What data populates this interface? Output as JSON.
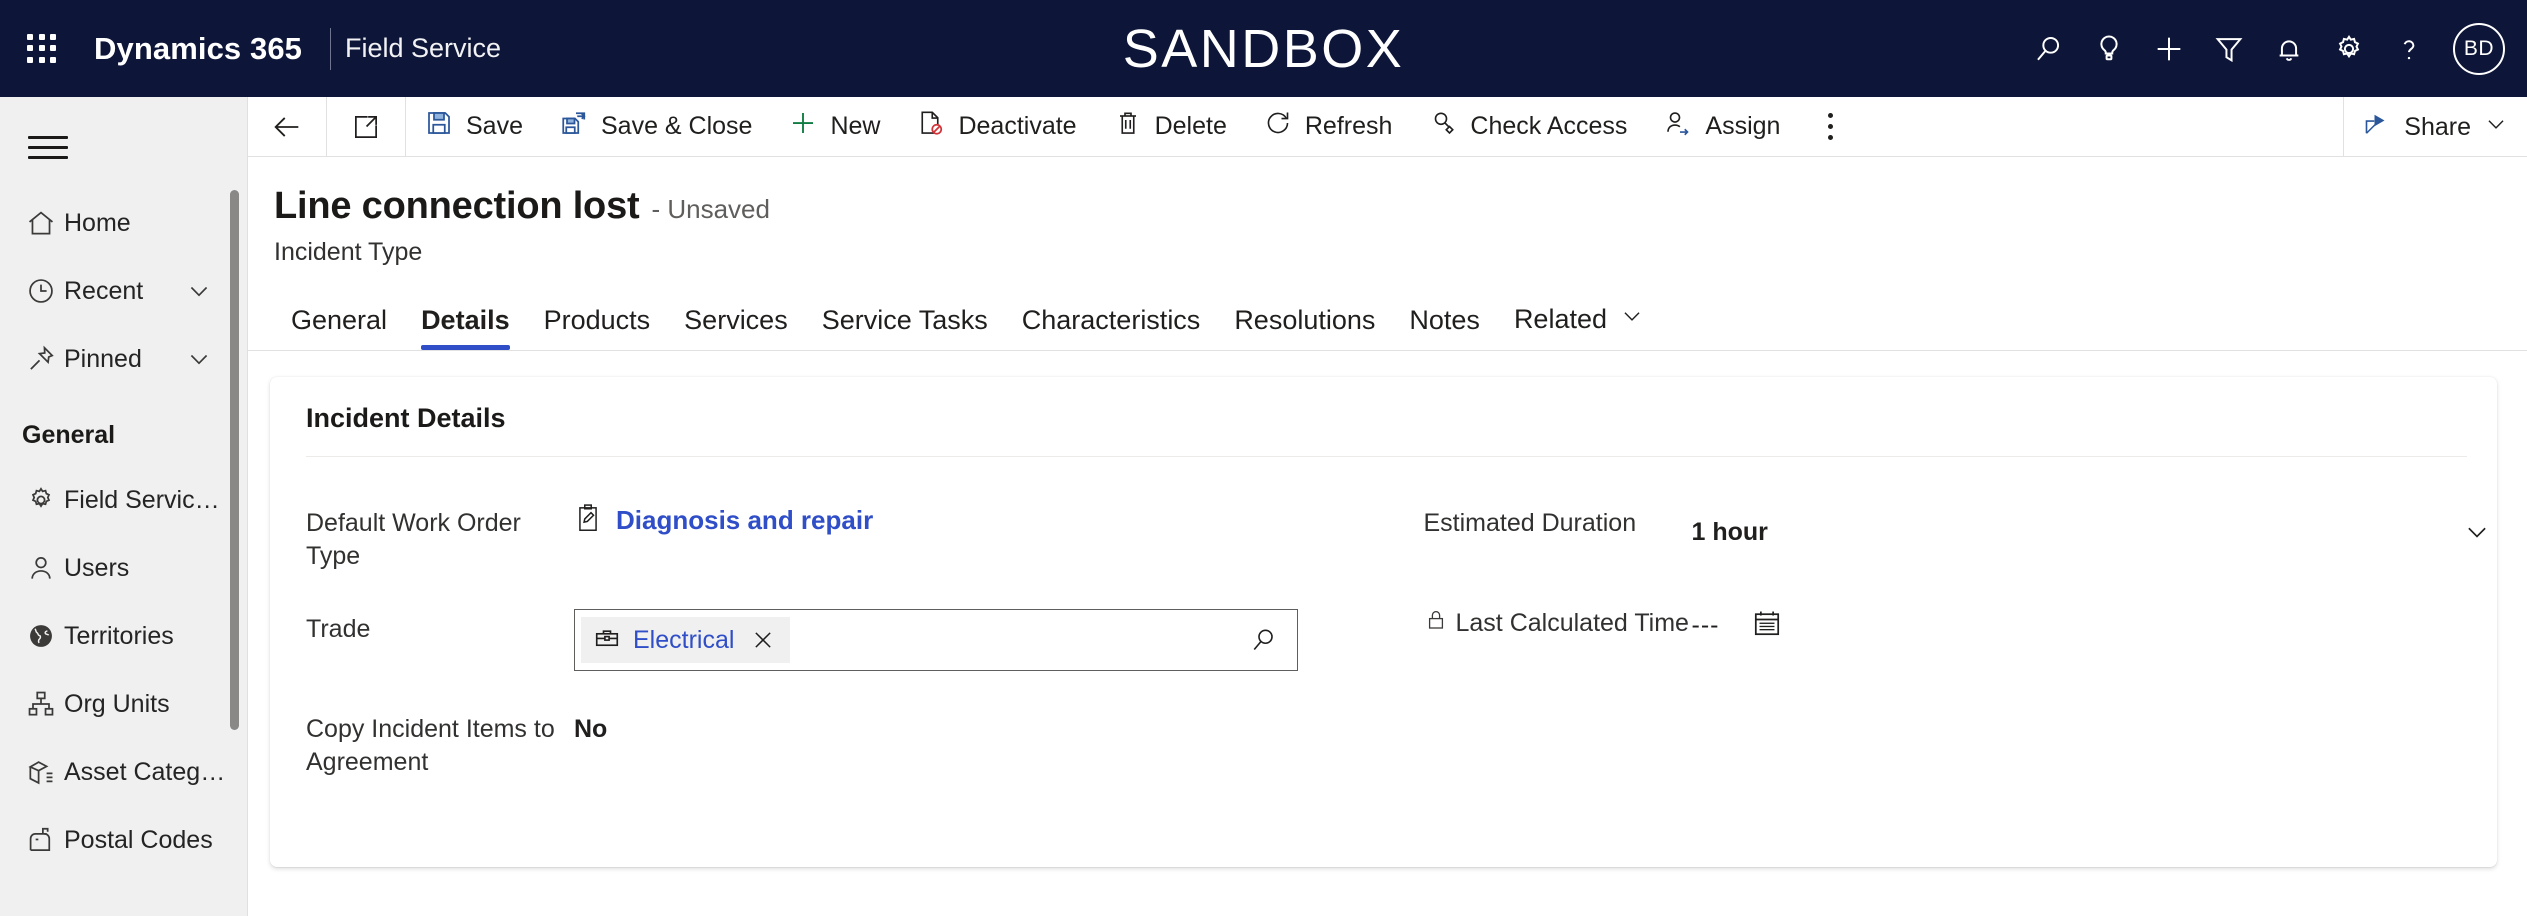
{
  "topbar": {
    "waffle_label": "app-launcher",
    "brand": "Dynamics 365",
    "app_name": "Field Service",
    "environment_banner": "SANDBOX",
    "actions": [
      {
        "name": "search-icon",
        "label": "Search"
      },
      {
        "name": "lightbulb-icon",
        "label": "Insights"
      },
      {
        "name": "plus-icon",
        "label": "Quick create"
      },
      {
        "name": "filter-icon",
        "label": "Filter"
      },
      {
        "name": "bell-icon",
        "label": "Notifications"
      },
      {
        "name": "gear-icon",
        "label": "Settings"
      },
      {
        "name": "question-icon",
        "label": "Help"
      }
    ],
    "avatar_initials": "BD"
  },
  "sidebar": {
    "hamburger_label": "Expand navigation",
    "top_items": [
      {
        "label": "Home",
        "icon": "home-icon",
        "chevron": false
      },
      {
        "label": "Recent",
        "icon": "clock-icon",
        "chevron": true
      },
      {
        "label": "Pinned",
        "icon": "pin-icon",
        "chevron": true
      }
    ],
    "group_title": "General",
    "group_items": [
      {
        "label": "Field Service Setti...",
        "icon": "gear-icon"
      },
      {
        "label": "Users",
        "icon": "person-icon"
      },
      {
        "label": "Territories",
        "icon": "globe-icon"
      },
      {
        "label": "Org Units",
        "icon": "org-chart-icon"
      },
      {
        "label": "Asset Categories",
        "icon": "box-list-icon"
      },
      {
        "label": "Postal Codes",
        "icon": "mailbox-icon"
      }
    ]
  },
  "commandbar": {
    "back_label": "Back",
    "popout_label": "Open in new window",
    "buttons": [
      {
        "label": "Save",
        "icon": "save-icon"
      },
      {
        "label": "Save & Close",
        "icon": "save-close-icon"
      },
      {
        "label": "New",
        "icon": "plus-icon"
      },
      {
        "label": "Deactivate",
        "icon": "deactivate-icon"
      },
      {
        "label": "Delete",
        "icon": "trash-icon"
      },
      {
        "label": "Refresh",
        "icon": "refresh-icon"
      },
      {
        "label": "Check Access",
        "icon": "check-access-icon"
      },
      {
        "label": "Assign",
        "icon": "assign-icon"
      }
    ],
    "overflow_label": "More commands",
    "share_label": "Share"
  },
  "record": {
    "title": "Line connection lost",
    "state": "- Unsaved",
    "entity": "Incident Type"
  },
  "tabs": [
    {
      "label": "General",
      "active": false
    },
    {
      "label": "Details",
      "active": true
    },
    {
      "label": "Products",
      "active": false
    },
    {
      "label": "Services",
      "active": false
    },
    {
      "label": "Service Tasks",
      "active": false
    },
    {
      "label": "Characteristics",
      "active": false
    },
    {
      "label": "Resolutions",
      "active": false
    },
    {
      "label": "Notes",
      "active": false
    },
    {
      "label": "Related",
      "active": false
    }
  ],
  "form": {
    "section_title": "Incident Details",
    "left_fields": [
      {
        "label": "Default Work Order Type",
        "type": "link",
        "value": "Diagnosis and repair",
        "icon": "clipboard-pencil-icon"
      },
      {
        "label": "Trade",
        "type": "lookup",
        "value": "Electrical",
        "chip_icon": "toolbox-icon",
        "clear_label": "Remove Electrical",
        "search_label": "Lookup records"
      },
      {
        "label": "Copy Incident Items to Agreement",
        "type": "text",
        "value": "No"
      }
    ],
    "right_fields": [
      {
        "label": "Estimated Duration",
        "type": "combo",
        "value": "1 hour",
        "locked": false
      },
      {
        "label": "Last Calculated Time",
        "type": "date",
        "value": "---",
        "locked": true,
        "calendar_label": "Select date"
      }
    ]
  },
  "colors": {
    "header_bg": "#0d1638",
    "accent_blue": "#2f4ec7",
    "sidebar_bg": "#f0f0f0",
    "text_primary": "#1b1a19",
    "text_secondary": "#605e5c",
    "green_plus": "#107c41",
    "red_deactivate": "#d13438"
  }
}
